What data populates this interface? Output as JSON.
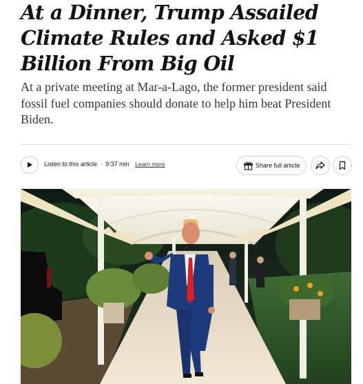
{
  "article": {
    "headline": "At a Dinner, Trump Assailed Climate Rules and Asked $1 Billion From Big Oil",
    "summary": "At a private meeting at Mar-a-Lago, the former president said fossil fuel companies should donate to help him beat President Biden."
  },
  "toolbar": {
    "listen_label": "Listen to this article",
    "separator": "·",
    "duration": "9:37 min",
    "learn_more": "Learn more",
    "share_full_label": "Share full article",
    "play_icon": "play-icon",
    "gift_icon": "gift-icon",
    "share_icon": "share-arrow-icon",
    "bookmark_icon": "bookmark-icon"
  },
  "photo": {
    "subject": "man in navy suit and red tie walking under white canopy walkway at night"
  },
  "colors": {
    "text": "#121212",
    "summary_text": "#363636",
    "rule": "#dfdfdf",
    "button_border": "#cfcfcf"
  }
}
